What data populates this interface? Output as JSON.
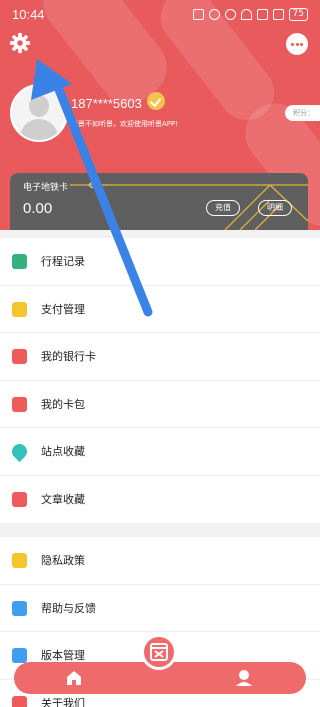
{
  "status_bar": {
    "time": "10:44",
    "battery": "75"
  },
  "header": {
    "phone": "187****5603",
    "slogan": "看景不如听景，欢迎使用听景APP!",
    "points_label": "积分："
  },
  "metro_card": {
    "title": "电子地铁卡",
    "balance": "0.00",
    "recharge_label": "充值",
    "detail_label": "明细"
  },
  "menu": {
    "items": [
      {
        "label": "行程记录",
        "icon": "trip-record-icon",
        "color": "#34b27d"
      },
      {
        "label": "支付管理",
        "icon": "payment-icon",
        "color": "#f4c52c"
      },
      {
        "label": "我的银行卡",
        "icon": "bank-card-icon",
        "color": "#ef5a5a"
      },
      {
        "label": "我的卡包",
        "icon": "card-wallet-icon",
        "color": "#ef5a5a"
      },
      {
        "label": "站点收藏",
        "icon": "location-pin-icon",
        "color": "#35c1b6"
      },
      {
        "label": "文章收藏",
        "icon": "star-icon",
        "color": "#ef5a5a"
      }
    ],
    "items2": [
      {
        "label": "隐私政策",
        "icon": "privacy-icon",
        "color": "#f4c52c"
      },
      {
        "label": "帮助与反馈",
        "icon": "help-icon",
        "color": "#3f9ef0"
      },
      {
        "label": "版本管理",
        "icon": "version-icon",
        "color": "#3f9ef0"
      },
      {
        "label": "关于我们",
        "icon": "about-icon",
        "color": "#ef5a5a"
      }
    ]
  },
  "colors": {
    "brand": "#e85a5b",
    "card": "#5f5f5f",
    "accent_gold": "#f0b93a",
    "arrow": "#3b82e6"
  }
}
